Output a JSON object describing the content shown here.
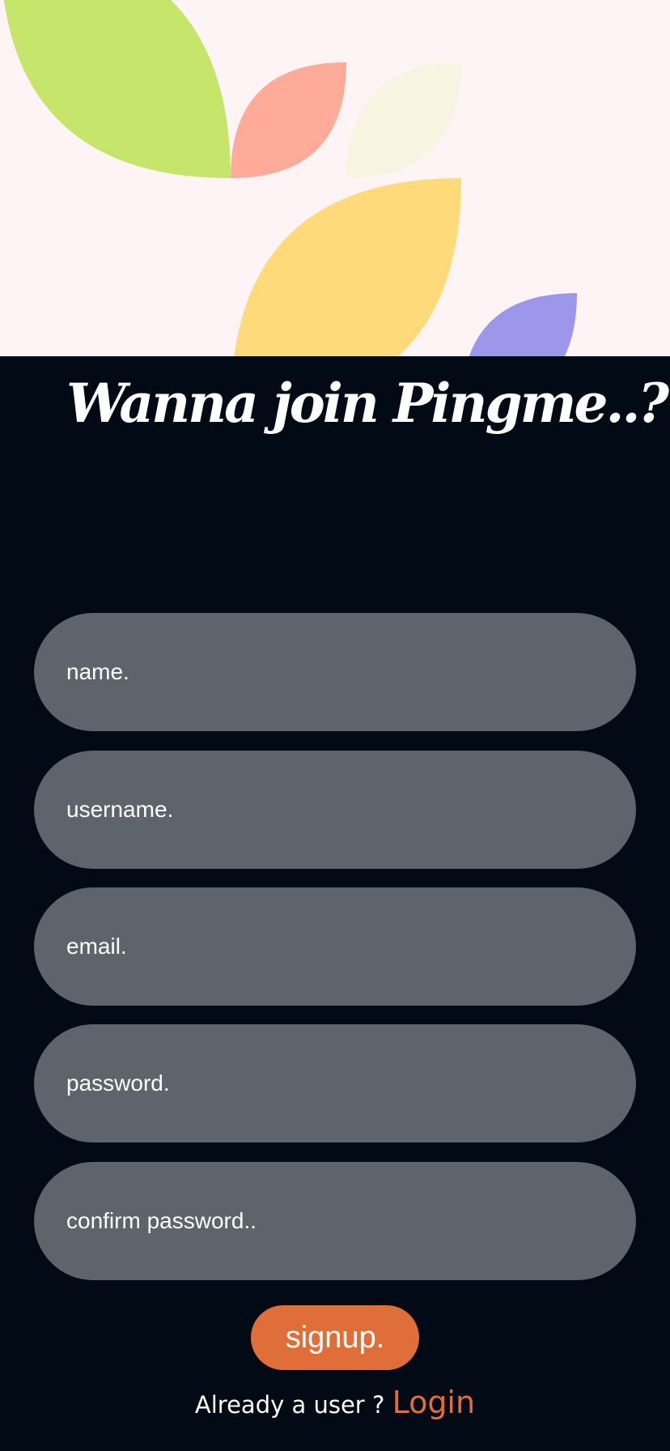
{
  "colors": {
    "background": "#010a15",
    "hero_background": "#fff4f5",
    "field_background": "#5d646b",
    "accent": "#e06e38",
    "text": "#ffffff",
    "leaf_green": "#c5e66a",
    "leaf_salmon": "#ffab9a",
    "leaf_cream": "#f7f4e2",
    "leaf_yellow": "#ffda7a",
    "leaf_purple": "#9c97eb"
  },
  "header": {
    "title": "Wanna join Pingme..?"
  },
  "form": {
    "fields": [
      {
        "placeholder": "name."
      },
      {
        "placeholder": "username."
      },
      {
        "placeholder": "email."
      },
      {
        "placeholder": "password."
      },
      {
        "placeholder": "confirm password.."
      }
    ],
    "submit_label": "signup."
  },
  "footer": {
    "prompt": "Already a user ?",
    "login_label": "Login"
  }
}
